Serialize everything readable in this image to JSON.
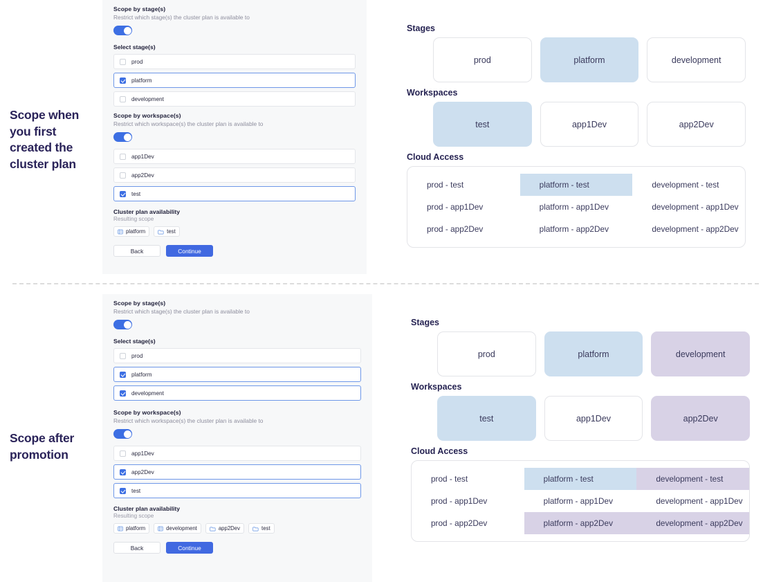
{
  "captions": {
    "top": "Scope when you first created the cluster plan",
    "bottom": "Scope after promotion"
  },
  "colors": {
    "accent_blue": "#4169e1",
    "highlight_blue": "#cddfef",
    "highlight_purple": "#d8d2e6",
    "text_navy": "#26235c",
    "panel_bg": "#f7f8f9"
  },
  "form_top": {
    "stage_section": {
      "title": "Scope by stage(s)",
      "subtitle": "Restrict which stage(s) the cluster plan is available to",
      "toggle_on": true,
      "select_label": "Select stage(s)",
      "options": [
        {
          "label": "prod",
          "checked": false
        },
        {
          "label": "platform",
          "checked": true
        },
        {
          "label": "development",
          "checked": false
        }
      ]
    },
    "workspace_section": {
      "title": "Scope by workspace(s)",
      "subtitle": "Restrict which workspace(s) the cluster plan is available to",
      "toggle_on": true,
      "options": [
        {
          "label": "app1Dev",
          "checked": false
        },
        {
          "label": "app2Dev",
          "checked": false
        },
        {
          "label": "test",
          "checked": true
        }
      ]
    },
    "availability": {
      "title": "Cluster plan availability",
      "subtitle": "Resulting scope",
      "chips": [
        {
          "label": "platform",
          "icon": "stage-icon"
        },
        {
          "label": "test",
          "icon": "folder-icon"
        }
      ]
    },
    "buttons": {
      "back": "Back",
      "continue": "Continue"
    }
  },
  "form_bottom": {
    "stage_section": {
      "title": "Scope by stage(s)",
      "subtitle": "Restrict which stage(s) the cluster plan is available to",
      "toggle_on": true,
      "select_label": "Select stage(s)",
      "options": [
        {
          "label": "prod",
          "checked": false
        },
        {
          "label": "platform",
          "checked": true
        },
        {
          "label": "development",
          "checked": true
        }
      ]
    },
    "workspace_section": {
      "title": "Scope by workspace(s)",
      "subtitle": "Restrict which workspace(s) the cluster plan is available to",
      "toggle_on": true,
      "options": [
        {
          "label": "app1Dev",
          "checked": false
        },
        {
          "label": "app2Dev",
          "checked": true
        },
        {
          "label": "test",
          "checked": true
        }
      ]
    },
    "availability": {
      "title": "Cluster plan availability",
      "subtitle": "Resulting scope",
      "chips": [
        {
          "label": "platform",
          "icon": "stage-icon"
        },
        {
          "label": "development",
          "icon": "stage-icon"
        },
        {
          "label": "app2Dev",
          "icon": "folder-icon"
        },
        {
          "label": "test",
          "icon": "folder-icon"
        }
      ]
    },
    "buttons": {
      "back": "Back",
      "continue": "Continue"
    }
  },
  "diagram_top": {
    "stages_label": "Stages",
    "stages": [
      {
        "label": "prod",
        "state": "none"
      },
      {
        "label": "platform",
        "state": "blue"
      },
      {
        "label": "development",
        "state": "none"
      }
    ],
    "workspaces_label": "Workspaces",
    "workspaces": [
      {
        "label": "test",
        "state": "blue"
      },
      {
        "label": "app1Dev",
        "state": "none"
      },
      {
        "label": "app2Dev",
        "state": "none"
      }
    ],
    "cloud_access_label": "Cloud Access",
    "cloud_access": [
      {
        "label": "prod - test",
        "state": "none"
      },
      {
        "label": "platform - test",
        "state": "blue"
      },
      {
        "label": "development - test",
        "state": "none"
      },
      {
        "label": "prod - app1Dev",
        "state": "none"
      },
      {
        "label": "platform - app1Dev",
        "state": "none"
      },
      {
        "label": "development - app1Dev",
        "state": "none"
      },
      {
        "label": "prod - app2Dev",
        "state": "none"
      },
      {
        "label": "platform - app2Dev",
        "state": "none"
      },
      {
        "label": "development - app2Dev",
        "state": "none"
      }
    ]
  },
  "diagram_bottom": {
    "stages_label": "Stages",
    "stages": [
      {
        "label": "prod",
        "state": "none"
      },
      {
        "label": "platform",
        "state": "blue"
      },
      {
        "label": "development",
        "state": "purple"
      }
    ],
    "workspaces_label": "Workspaces",
    "workspaces": [
      {
        "label": "test",
        "state": "blue"
      },
      {
        "label": "app1Dev",
        "state": "none"
      },
      {
        "label": "app2Dev",
        "state": "purple"
      }
    ],
    "cloud_access_label": "Cloud Access",
    "cloud_access": [
      {
        "label": "prod - test",
        "state": "none"
      },
      {
        "label": "platform - test",
        "state": "blue"
      },
      {
        "label": "development - test",
        "state": "purple"
      },
      {
        "label": "prod - app1Dev",
        "state": "none"
      },
      {
        "label": "platform - app1Dev",
        "state": "none"
      },
      {
        "label": "development - app1Dev",
        "state": "none"
      },
      {
        "label": "prod - app2Dev",
        "state": "none"
      },
      {
        "label": "platform - app2Dev",
        "state": "purple"
      },
      {
        "label": "development - app2Dev",
        "state": "purple"
      }
    ]
  }
}
